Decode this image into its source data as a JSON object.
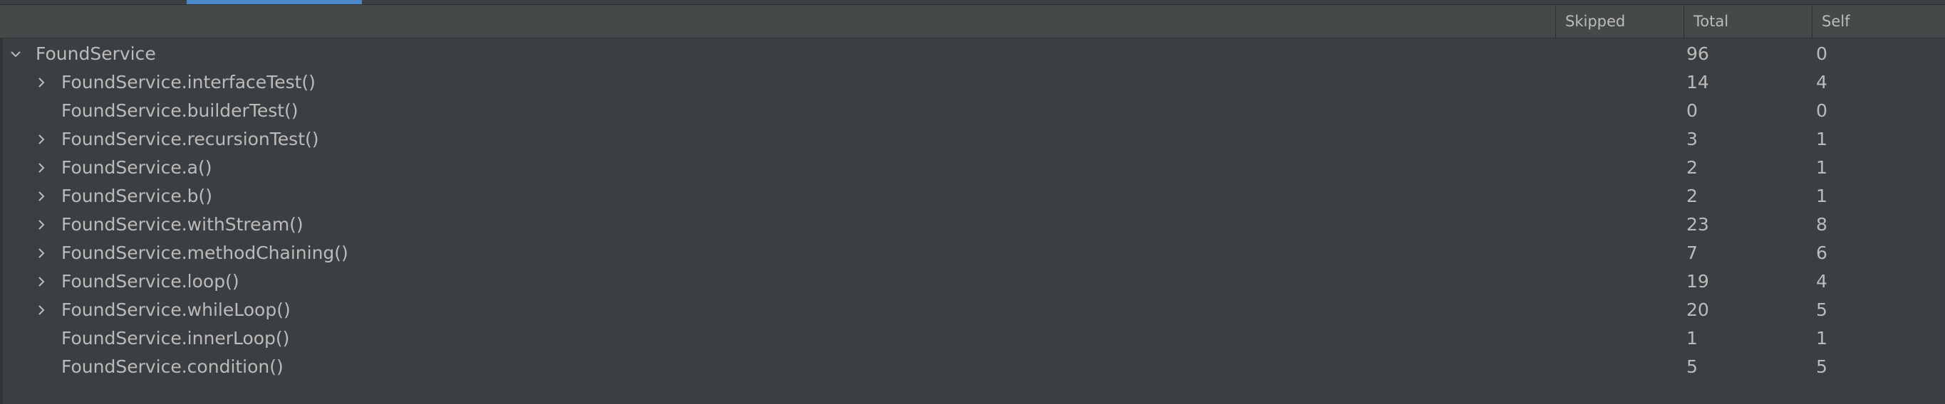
{
  "columns": {
    "skipped": "Skipped",
    "total": "Total",
    "self": "Self"
  },
  "root": {
    "name": "FoundService",
    "total": "96",
    "self": "0",
    "expanded": true
  },
  "children": [
    {
      "name": "FoundService.interfaceTest()",
      "total": "14",
      "self": "4",
      "expandable": true
    },
    {
      "name": "FoundService.builderTest()",
      "total": "0",
      "self": "0",
      "expandable": false
    },
    {
      "name": "FoundService.recursionTest()",
      "total": "3",
      "self": "1",
      "expandable": true
    },
    {
      "name": "FoundService.a()",
      "total": "2",
      "self": "1",
      "expandable": true
    },
    {
      "name": "FoundService.b()",
      "total": "2",
      "self": "1",
      "expandable": true
    },
    {
      "name": "FoundService.withStream()",
      "total": "23",
      "self": "8",
      "expandable": true
    },
    {
      "name": "FoundService.methodChaining()",
      "total": "7",
      "self": "6",
      "expandable": true
    },
    {
      "name": "FoundService.loop()",
      "total": "19",
      "self": "4",
      "expandable": true
    },
    {
      "name": "FoundService.whileLoop()",
      "total": "20",
      "self": "5",
      "expandable": true
    },
    {
      "name": "FoundService.innerLoop()",
      "total": "1",
      "self": "1",
      "expandable": false
    },
    {
      "name": "FoundService.condition()",
      "total": "5",
      "self": "5",
      "expandable": false
    }
  ],
  "colors": {
    "background": "#3c3f41",
    "header": "#45494a",
    "text": "#bbbbbb",
    "accent": "#4a88c7"
  },
  "icons": {
    "expanded": "chevron-down-icon",
    "collapsed": "chevron-right-icon"
  }
}
